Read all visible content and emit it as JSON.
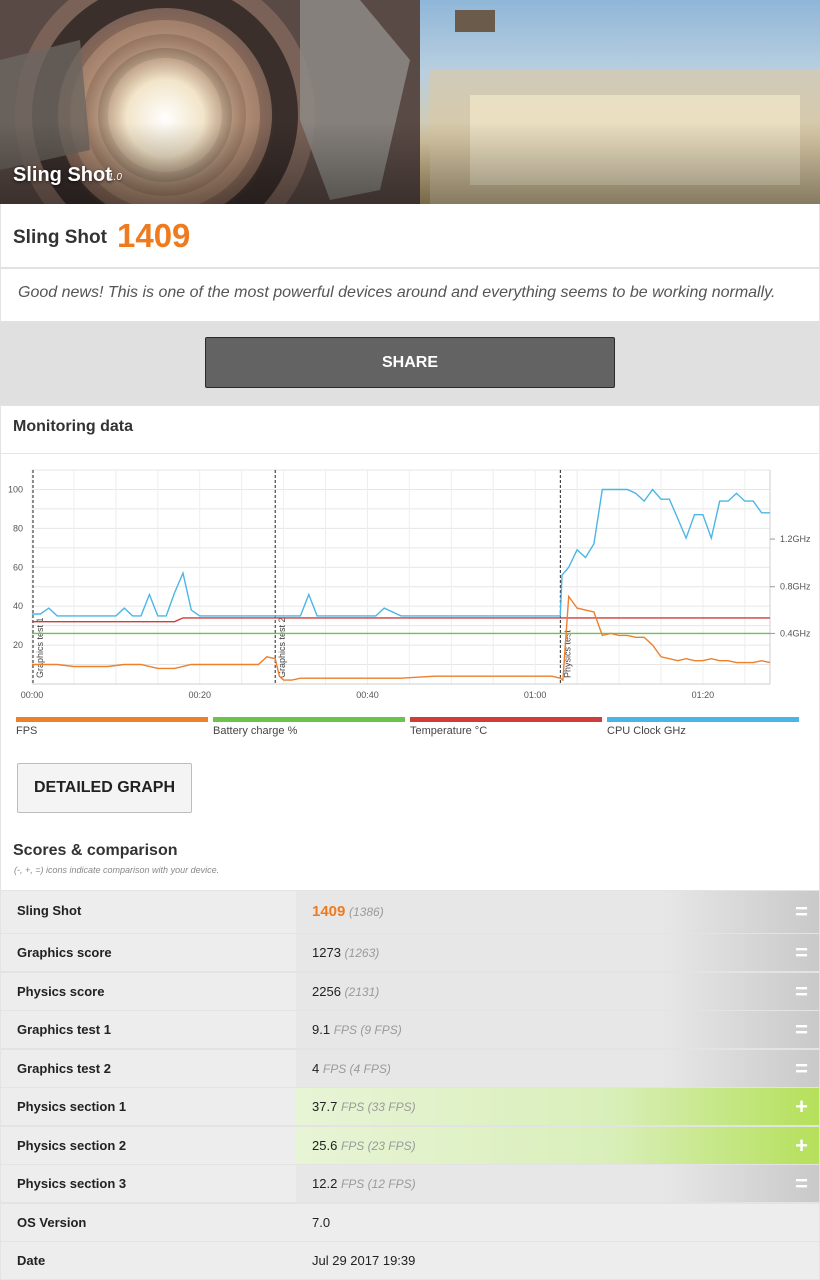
{
  "hero": {
    "title": "Sling Shot",
    "version": "1.0"
  },
  "score": {
    "name": "Sling Shot",
    "value": "1409"
  },
  "message": "Good news! This is one of the most powerful devices around and everything seems to be working normally.",
  "share_label": "SHARE",
  "monitoring": {
    "title": "Monitoring data",
    "detail_button": "DETAILED GRAPH",
    "legend": [
      {
        "label": "FPS",
        "color": "#ee7f2d"
      },
      {
        "label": "Battery charge %",
        "color": "#6cc24a"
      },
      {
        "label": "Temperature °C",
        "color": "#d23b3b"
      },
      {
        "label": "CPU Clock GHz",
        "color": "#4bb6e6"
      }
    ]
  },
  "chart_data": {
    "type": "line",
    "x_ticks": [
      "00:00",
      "00:20",
      "00:40",
      "01:00",
      "01:20"
    ],
    "y_ticks": [
      "20",
      "40",
      "60",
      "80",
      "100"
    ],
    "y2_ticks": [
      "0.4GHz",
      "0.8GHz",
      "1.2GHz"
    ],
    "ylim": [
      0,
      100
    ],
    "markers": [
      {
        "label": "Graphics test 1",
        "x_sec": 0
      },
      {
        "label": "Graphics test 2",
        "x_sec": 29
      },
      {
        "label": "Physics test",
        "x_sec": 63
      }
    ],
    "series": [
      {
        "name": "CPU Clock GHz",
        "color": "#4bb6e6",
        "x_sec": [
          0,
          1,
          2,
          3,
          4,
          5,
          6,
          7,
          8,
          9,
          10,
          11,
          12,
          13,
          14,
          15,
          16,
          17,
          18,
          19,
          20,
          22,
          24,
          26,
          28,
          29,
          30,
          31,
          32,
          33,
          34,
          35,
          36,
          37,
          38,
          39,
          40,
          41,
          42,
          44,
          46,
          48,
          50,
          52,
          54,
          56,
          58,
          60,
          62,
          63,
          63.2,
          64,
          65,
          66,
          67,
          68,
          69,
          70,
          71,
          72,
          73,
          74,
          75,
          76,
          77,
          78,
          79,
          80,
          81,
          82,
          83,
          84,
          85,
          86,
          87,
          88
        ],
        "values": [
          36,
          36,
          39,
          35,
          35,
          35,
          35,
          35,
          35,
          35,
          35,
          39,
          35,
          35,
          46,
          35,
          35,
          47,
          57,
          38,
          35,
          35,
          35,
          35,
          35,
          35,
          35,
          35,
          35,
          46,
          35,
          35,
          35,
          35,
          35,
          35,
          35,
          35,
          39,
          35,
          35,
          35,
          35,
          35,
          35,
          35,
          35,
          35,
          35,
          35,
          56,
          60,
          69,
          65,
          72,
          100,
          100,
          100,
          100,
          98,
          94,
          100,
          95,
          95,
          85,
          75,
          87,
          87,
          75,
          94,
          94,
          98,
          94,
          94,
          88,
          88
        ]
      },
      {
        "name": "FPS",
        "color": "#ee7f2d",
        "x_sec": [
          0,
          1,
          3,
          5,
          7,
          9,
          11,
          13,
          15,
          17,
          19,
          21,
          23,
          25,
          27,
          28,
          29,
          29.5,
          30,
          31,
          32,
          36,
          40,
          44,
          48,
          52,
          56,
          60,
          62,
          63,
          63.3,
          64,
          65,
          66,
          67,
          68,
          69,
          70,
          71,
          72,
          73,
          74,
          75,
          76,
          77,
          78,
          79,
          80,
          81,
          82,
          83,
          84,
          85,
          86,
          87,
          88
        ],
        "values": [
          10,
          10,
          10,
          9,
          9,
          9,
          10,
          10,
          8,
          8,
          10,
          10,
          10,
          10,
          10,
          14,
          13,
          4,
          2,
          2,
          3,
          3,
          3,
          3,
          4,
          4,
          4,
          4,
          4,
          3,
          2,
          45,
          39,
          38,
          37,
          25,
          26,
          25,
          25,
          24,
          24,
          20,
          14,
          13,
          12,
          13,
          12,
          12,
          13,
          12,
          12,
          11,
          11,
          11,
          12,
          11
        ]
      },
      {
        "name": "Temperature °C",
        "color": "#d23b3b",
        "x_sec": [
          0,
          17,
          18,
          60,
          63,
          88
        ],
        "values": [
          32,
          32,
          34,
          34,
          34,
          34
        ]
      },
      {
        "name": "Battery charge %",
        "color": "#6cc24a",
        "x_sec": [
          0,
          88
        ],
        "values": [
          26,
          26
        ]
      }
    ]
  },
  "scores": {
    "title": "Scores & comparison",
    "note": "(-, +, =) icons indicate comparison with your device.",
    "rows": [
      {
        "label": "Sling Shot",
        "value": "1409",
        "compare": "(1386)",
        "icon": "=",
        "style": "eq",
        "highlight": true
      },
      {
        "label": "Graphics score",
        "value": "1273",
        "compare": "(1263)",
        "icon": "=",
        "style": "eq"
      },
      {
        "label": "Physics score",
        "value": "2256",
        "compare": "(2131)",
        "icon": "=",
        "style": "eq"
      },
      {
        "label": "Graphics test 1",
        "value": "9.1",
        "compare": "FPS (9 FPS)",
        "icon": "=",
        "style": "eq"
      },
      {
        "label": "Graphics test 2",
        "value": "4",
        "compare": "FPS (4 FPS)",
        "icon": "=",
        "style": "eq"
      },
      {
        "label": "Physics section 1",
        "value": "37.7",
        "compare": "FPS (33 FPS)",
        "icon": "+",
        "style": "plus"
      },
      {
        "label": "Physics section 2",
        "value": "25.6",
        "compare": "FPS (23 FPS)",
        "icon": "+",
        "style": "plus"
      },
      {
        "label": "Physics section 3",
        "value": "12.2",
        "compare": "FPS (12 FPS)",
        "icon": "=",
        "style": "eq"
      },
      {
        "label": "OS Version",
        "value": "7.0",
        "compare": "",
        "icon": "",
        "style": "plain"
      },
      {
        "label": "Date",
        "value": "Jul 29 2017 19:39",
        "compare": "",
        "icon": "",
        "style": "plain"
      }
    ]
  }
}
